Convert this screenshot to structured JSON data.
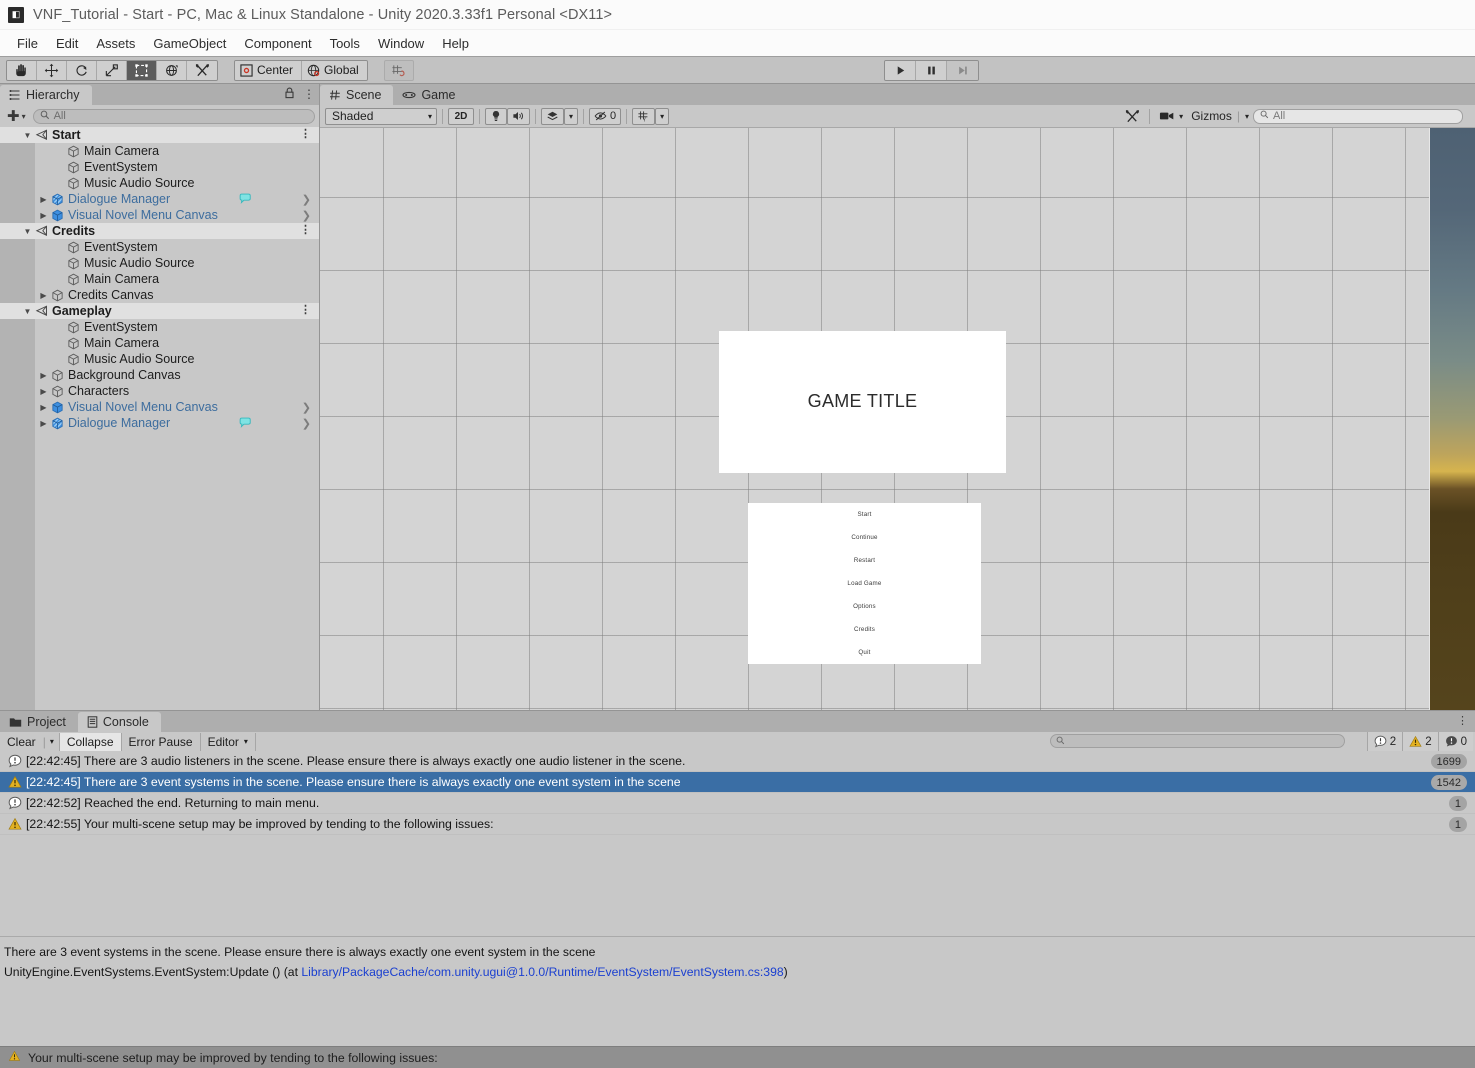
{
  "window": {
    "title": "VNF_Tutorial - Start - PC, Mac & Linux Standalone - Unity 2020.3.33f1 Personal <DX11>",
    "app_icon": "unity-icon"
  },
  "menubar": {
    "items": [
      "File",
      "Edit",
      "Assets",
      "GameObject",
      "Component",
      "Tools",
      "Window",
      "Help"
    ]
  },
  "toolbar": {
    "tools": [
      {
        "name": "hand-tool",
        "selected": false
      },
      {
        "name": "move-tool",
        "selected": false
      },
      {
        "name": "rotate-tool",
        "selected": false
      },
      {
        "name": "scale-tool",
        "selected": false
      },
      {
        "name": "rect-transform-tool",
        "selected": true
      },
      {
        "name": "transform-tool",
        "selected": false
      },
      {
        "name": "custom-editor-tool",
        "selected": false
      }
    ],
    "pivot_label": "Center",
    "handle_label": "Global",
    "snap_label": "grid-snapping",
    "play": "play-button",
    "pause": "pause-button",
    "step": "step-button"
  },
  "hierarchy": {
    "tab_label": "Hierarchy",
    "search_placeholder": "All",
    "add_label": "+",
    "rows": [
      {
        "label": "Start",
        "type": "scene",
        "depth": 0,
        "expanded": true,
        "kebab": true
      },
      {
        "label": "Main Camera",
        "type": "gameobject",
        "depth": 2
      },
      {
        "label": "EventSystem",
        "type": "gameobject",
        "depth": 2
      },
      {
        "label": "Music Audio Source",
        "type": "gameobject",
        "depth": 2
      },
      {
        "label": "Dialogue Manager",
        "type": "prefab-variant",
        "depth": 1,
        "collapsed": true,
        "bubble": true,
        "chevron": true
      },
      {
        "label": "Visual Novel Menu Canvas",
        "type": "prefab",
        "depth": 1,
        "collapsed": true,
        "chevron": true
      },
      {
        "label": "Credits",
        "type": "scene",
        "depth": 0,
        "expanded": true,
        "kebab": true
      },
      {
        "label": "EventSystem",
        "type": "gameobject",
        "depth": 2
      },
      {
        "label": "Music Audio Source",
        "type": "gameobject",
        "depth": 2
      },
      {
        "label": "Main Camera",
        "type": "gameobject",
        "depth": 2
      },
      {
        "label": "Credits Canvas",
        "type": "gameobject",
        "depth": 1,
        "collapsed": true
      },
      {
        "label": "Gameplay",
        "type": "scene",
        "depth": 0,
        "expanded": true,
        "kebab": true
      },
      {
        "label": "EventSystem",
        "type": "gameobject",
        "depth": 2
      },
      {
        "label": "Main Camera",
        "type": "gameobject",
        "depth": 2
      },
      {
        "label": "Music Audio Source",
        "type": "gameobject",
        "depth": 2
      },
      {
        "label": "Background Canvas",
        "type": "gameobject",
        "depth": 1,
        "collapsed": true
      },
      {
        "label": "Characters",
        "type": "gameobject",
        "depth": 1,
        "collapsed": true
      },
      {
        "label": "Visual Novel Menu Canvas",
        "type": "prefab",
        "depth": 1,
        "collapsed": true,
        "chevron": true
      },
      {
        "label": "Dialogue Manager",
        "type": "prefab-variant",
        "depth": 1,
        "collapsed": true,
        "bubble": true,
        "chevron": true
      }
    ]
  },
  "sceneview": {
    "tabs": [
      {
        "label": "Scene",
        "icon": "scene-icon",
        "active": true
      },
      {
        "label": "Game",
        "icon": "game-icon",
        "active": false
      }
    ],
    "draw_mode": "Shaded",
    "toggle_2d": "2D",
    "lighting_icon": "lighting-toggle-icon",
    "audio_icon": "audio-toggle-icon",
    "fx_icon": "effects-icon",
    "hidden_objects_count": "0",
    "grid_icon": "grid-visibility-icon",
    "tools_icon": "scene-tools-icon",
    "camera_icon": "scene-camera-icon",
    "gizmos_label": "Gizmos",
    "search_placeholder": "All",
    "game_title": "GAME TITLE",
    "menu_buttons": [
      "Start",
      "Continue",
      "Restart",
      "Load Game",
      "Options",
      "Credits",
      "Quit"
    ]
  },
  "bottom": {
    "tabs": [
      {
        "label": "Project",
        "icon": "folder-icon",
        "active": false
      },
      {
        "label": "Console",
        "icon": "console-icon",
        "active": true
      }
    ],
    "console_toolbar": {
      "clear": "Clear",
      "collapse": "Collapse",
      "error_pause": "Error Pause",
      "editor": "Editor",
      "search_placeholder": "",
      "counts": {
        "log": "2",
        "warning": "2",
        "error": "0"
      }
    },
    "logs": [
      {
        "icon": "log-info-icon",
        "text": "[22:42:45] There are 3 audio listeners in the scene. Please ensure there is always exactly one audio listener in the scene.",
        "count": "1699",
        "selected": false
      },
      {
        "icon": "log-warning-icon",
        "text": "[22:42:45] There are 3 event systems in the scene. Please ensure there is always exactly one event system in the scene",
        "count": "1542",
        "selected": true
      },
      {
        "icon": "log-info-icon",
        "text": "[22:42:52] Reached the end. Returning to main menu.",
        "count": "1",
        "selected": false
      },
      {
        "icon": "log-warning-icon",
        "text": "[22:42:55] Your multi-scene setup may be improved by tending to the following issues:",
        "count": "1",
        "selected": false
      }
    ],
    "detail": {
      "line1": "There are 3 event systems in the scene. Please ensure there is always exactly one event system in the scene",
      "line2_prefix": "UnityEngine.EventSystems.EventSystem:Update () (at ",
      "line2_link": "Library/PackageCache/com.unity.ugui@1.0.0/Runtime/EventSystem/EventSystem.cs:398",
      "line2_suffix": ")"
    }
  },
  "statusbar": {
    "icon": "warning-icon",
    "text": "Your multi-scene setup may be improved by tending to the following issues:"
  },
  "colors": {
    "chrome": "#c2c2c2",
    "panel": "#c8c8c8",
    "tabstrip": "#aeaeae",
    "selection": "#3a6ea5",
    "prefab_blue": "#3d6d9e",
    "link_blue": "#1a3fd0",
    "warning_yellow": "#e3b121"
  }
}
